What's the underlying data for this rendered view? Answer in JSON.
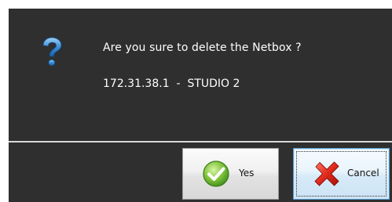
{
  "dialog": {
    "message": "Are you sure to delete the Netbox ?",
    "detail": "172.31.38.1  -  STUDIO 2",
    "icon": "question-icon",
    "background_color": "#2f2f2f"
  },
  "buttons": {
    "yes_label": "Yes",
    "yes_icon": "check-icon",
    "cancel_label": "Cancel",
    "cancel_icon": "x-icon",
    "focused": "cancel"
  }
}
